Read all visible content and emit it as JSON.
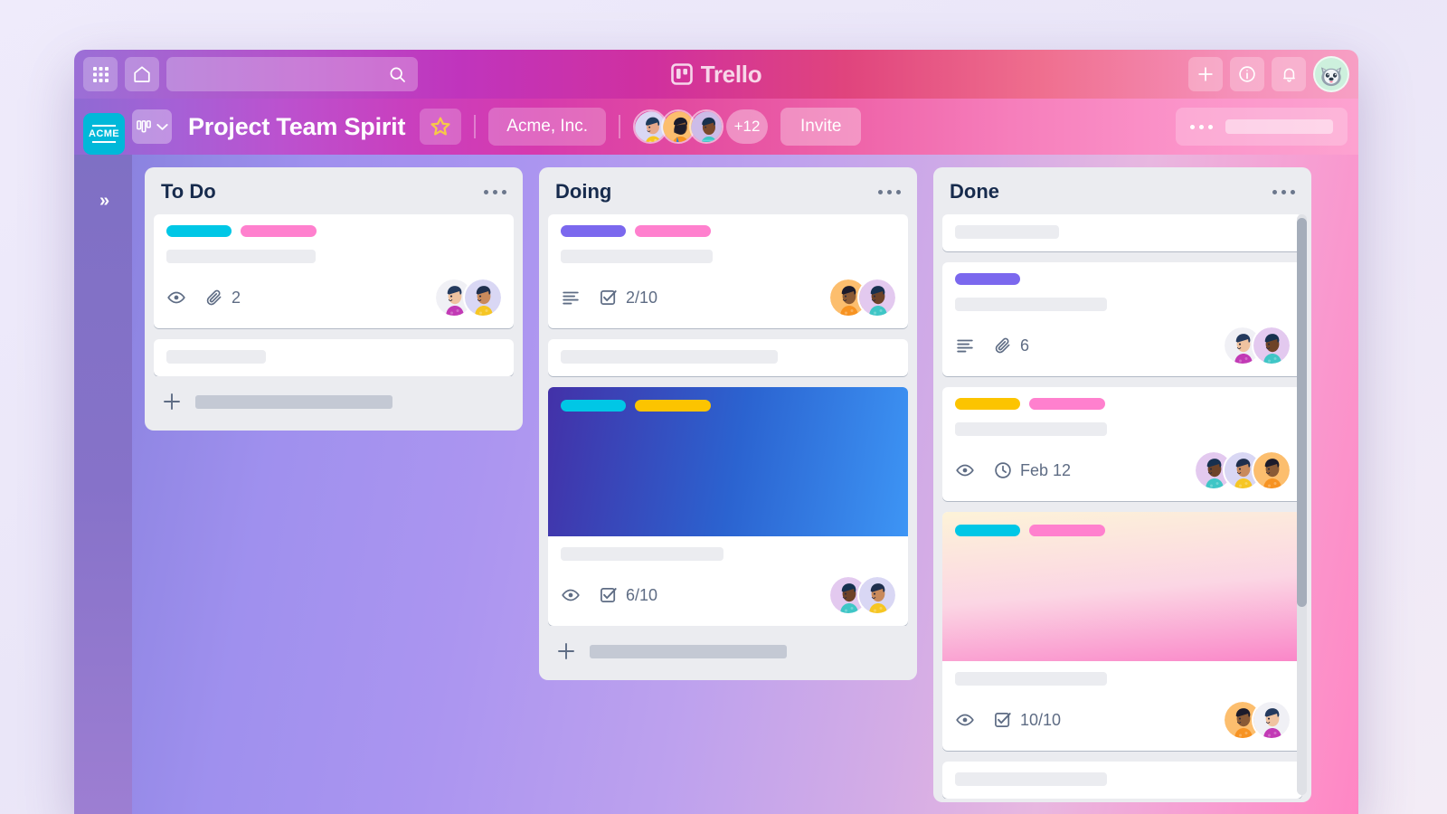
{
  "app": {
    "name": "Trello",
    "logo_icon": "trello-board-icon",
    "search_placeholder": "",
    "icons": {
      "apps_grid": "apps-grid-icon",
      "home": "home-icon",
      "search": "search-icon",
      "add": "plus-icon",
      "info": "info-circle-icon",
      "notifications": "bell-icon",
      "account_avatar": "husky-avatar-icon"
    }
  },
  "board_header": {
    "workspace_logo_text": "ACME",
    "view_switcher_icon": "board-columns-icon",
    "view_switcher_chevron": "chevron-down-icon",
    "board_title": "Project Team Spirit",
    "star_icon": "star-outline-icon",
    "workspace_name": "Acme, Inc.",
    "member_overflow": "+12",
    "invite_label": "Invite",
    "menu_icon": "ellipsis-icon",
    "members": [
      {
        "name": "member-avatar-1",
        "bg": "#d9d7f4",
        "skin": "#e7a98a",
        "hair": "#1f3b5c",
        "shirt": "#f6c623"
      },
      {
        "name": "member-avatar-2",
        "bg": "#fcbe6e",
        "skin": "#8a5a35",
        "hair": "#1b1b2b",
        "shirt": "#f79322"
      },
      {
        "name": "member-avatar-3",
        "bg": "#cdbce8",
        "skin": "#7b4a2c",
        "hair": "#19304d",
        "shirt": "#3fc6c6"
      }
    ]
  },
  "sidebar": {
    "expand_icon": "chevron-double-right-icon",
    "expand_label": "»"
  },
  "colors": {
    "label_cyan": "#00c7e6",
    "label_pink": "#ff80ce",
    "label_purple": "#7b68ee",
    "label_yellow": "#fcc400",
    "accent_cyan": "#00b8d9",
    "text_dark": "#172b4d",
    "text_muted": "#5e6c84",
    "list_bg": "#ebecf0"
  },
  "lists": [
    {
      "title": "To Do",
      "menu_icon": "ellipsis-icon",
      "add_card_icon": "plus-icon",
      "has_add_card": true,
      "scroll": false,
      "cards": [
        {
          "name": "card-todo-1",
          "labels": [
            "#00c7e6",
            "#ff80ce"
          ],
          "title_placeholder_width": 165,
          "cover": null,
          "badges": [
            {
              "icon": "eye-icon",
              "text": ""
            },
            {
              "icon": "paperclip-icon",
              "text": "2"
            }
          ],
          "members": [
            {
              "name": "card-avatar-a",
              "bg": "#f0f0f5",
              "skin": "#f0c3a0",
              "hair": "#243a5e",
              "shirt": "#c23ab5"
            },
            {
              "name": "card-avatar-b",
              "bg": "#d9d7f4",
              "skin": "#c98a5c",
              "hair": "#1f2f4d",
              "shirt": "#f6c623"
            }
          ]
        },
        {
          "name": "card-todo-2",
          "labels": [],
          "title_placeholder_width": 110,
          "cover": null,
          "badges": [],
          "members": []
        }
      ]
    },
    {
      "title": "Doing",
      "menu_icon": "ellipsis-icon",
      "add_card_icon": "plus-icon",
      "has_add_card": true,
      "scroll": false,
      "cards": [
        {
          "name": "card-doing-1",
          "labels": [
            "#7b68ee",
            "#ff80ce"
          ],
          "title_placeholder_width": 168,
          "cover": null,
          "badges": [
            {
              "icon": "description-icon",
              "text": ""
            },
            {
              "icon": "checklist-icon",
              "text": "2/10"
            }
          ],
          "members": [
            {
              "name": "card-avatar-c",
              "bg": "#fcbe6e",
              "skin": "#8a5a35",
              "hair": "#1b1b2b",
              "shirt": "#f79322"
            },
            {
              "name": "card-avatar-d",
              "bg": "#e3c9ef",
              "skin": "#6e4328",
              "hair": "#17304f",
              "shirt": "#3fc6c6"
            }
          ]
        },
        {
          "name": "card-doing-2",
          "labels": [],
          "title_placeholder_width": 240,
          "cover": null,
          "badges": [],
          "members": []
        },
        {
          "name": "card-doing-3",
          "labels": [
            "#00c7e6",
            "#fcc400"
          ],
          "title_placeholder_width": 180,
          "cover": {
            "type": "gradient",
            "from": "#4331a8",
            "via": "#2b63d0",
            "to": "#3d95f5",
            "angle": "100deg"
          },
          "badges": [
            {
              "icon": "eye-icon",
              "text": ""
            },
            {
              "icon": "checklist-icon",
              "text": "6/10"
            }
          ],
          "members": [
            {
              "name": "card-avatar-e",
              "bg": "#e3c9ef",
              "skin": "#6e4328",
              "hair": "#17304f",
              "shirt": "#3fc6c6"
            },
            {
              "name": "card-avatar-f",
              "bg": "#d9d7f4",
              "skin": "#c98a5c",
              "hair": "#1f2f4d",
              "shirt": "#f6c623"
            }
          ]
        }
      ]
    },
    {
      "title": "Done",
      "menu_icon": "ellipsis-icon",
      "add_card_icon": "plus-icon",
      "has_add_card": false,
      "scroll": true,
      "cards": [
        {
          "name": "card-done-1",
          "labels": [],
          "title_placeholder_width": 115,
          "cover": null,
          "badges": [],
          "members": []
        },
        {
          "name": "card-done-2",
          "labels": [
            "#7b68ee"
          ],
          "title_placeholder_width": 168,
          "cover": null,
          "badges": [
            {
              "icon": "description-icon",
              "text": ""
            },
            {
              "icon": "paperclip-icon",
              "text": "6"
            }
          ],
          "members": [
            {
              "name": "card-avatar-g",
              "bg": "#f0f0f5",
              "skin": "#f0c3a0",
              "hair": "#243a5e",
              "shirt": "#c23ab5"
            },
            {
              "name": "card-avatar-h",
              "bg": "#e3c9ef",
              "skin": "#6e4328",
              "hair": "#17304f",
              "shirt": "#3fc6c6"
            }
          ]
        },
        {
          "name": "card-done-3",
          "labels": [
            "#fcc400",
            "#ff80ce"
          ],
          "title_placeholder_width": 168,
          "cover": null,
          "badges": [
            {
              "icon": "eye-icon",
              "text": ""
            },
            {
              "icon": "clock-icon",
              "text": "Feb 12"
            }
          ],
          "members": [
            {
              "name": "card-avatar-i",
              "bg": "#e3c9ef",
              "skin": "#6e4328",
              "hair": "#17304f",
              "shirt": "#3fc6c6"
            },
            {
              "name": "card-avatar-j",
              "bg": "#d9d7f4",
              "skin": "#c98a5c",
              "hair": "#1f2f4d",
              "shirt": "#f6c623"
            },
            {
              "name": "card-avatar-k",
              "bg": "#fcbe6e",
              "skin": "#8a5a35",
              "hair": "#1b1b2b",
              "shirt": "#f79322"
            }
          ]
        },
        {
          "name": "card-done-4",
          "labels": [
            "#00c7e6",
            "#ff80ce"
          ],
          "title_placeholder_width": 168,
          "cover": {
            "type": "gradient",
            "from": "#fdf3d8",
            "via": "#fbd6e4",
            "to": "#fa86c8",
            "angle": "175deg"
          },
          "badges": [
            {
              "icon": "eye-icon",
              "text": ""
            },
            {
              "icon": "checklist-icon",
              "text": "10/10"
            }
          ],
          "members": [
            {
              "name": "card-avatar-l",
              "bg": "#fcbe6e",
              "skin": "#8a5a35",
              "hair": "#1b1b2b",
              "shirt": "#f79322"
            },
            {
              "name": "card-avatar-m",
              "bg": "#f0f0f5",
              "skin": "#f0c3a0",
              "hair": "#243a5e",
              "shirt": "#c23ab5"
            }
          ]
        },
        {
          "name": "card-done-5",
          "labels": [],
          "title_placeholder_width": 168,
          "cover": null,
          "badges": [],
          "members": []
        }
      ]
    }
  ]
}
